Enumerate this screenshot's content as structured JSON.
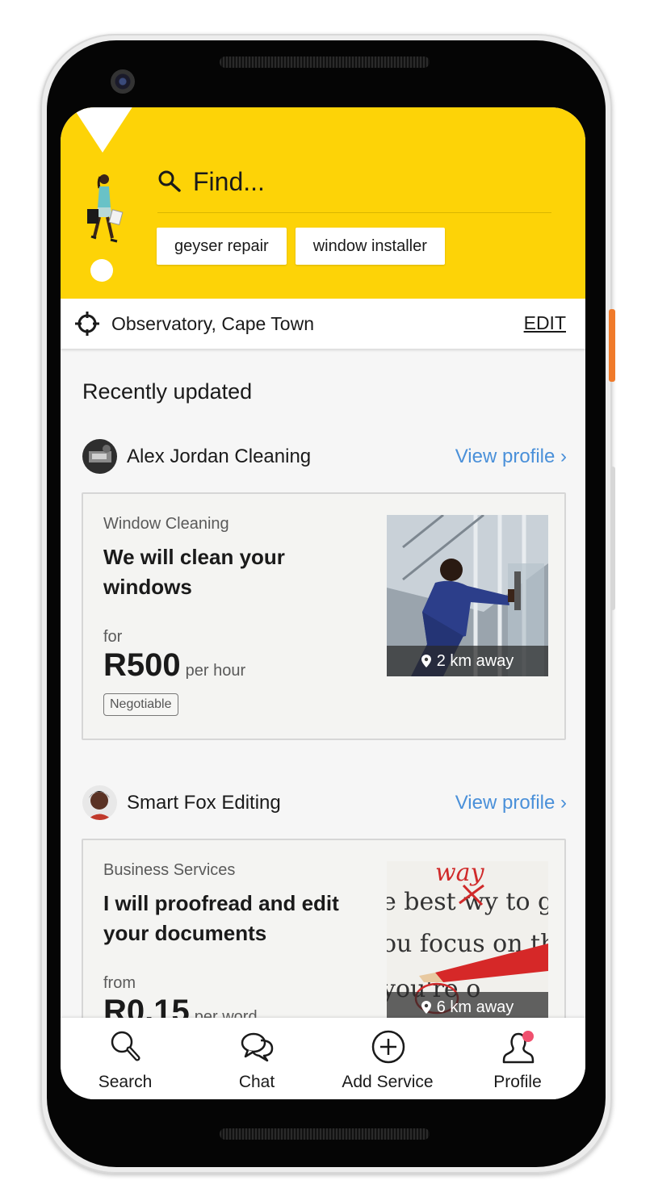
{
  "header": {
    "search_placeholder": "Find...",
    "chips": [
      "geyser repair",
      "window installer"
    ]
  },
  "location": {
    "text": "Observatory, Cape Town",
    "edit_label": "EDIT"
  },
  "section_title": "Recently updated",
  "listings": [
    {
      "provider": "Alex Jordan Cleaning",
      "view_profile": "View profile ›",
      "category": "Window Cleaning",
      "title": "We will clean your windows",
      "price_prefix": "for",
      "price": "R500",
      "price_unit": "per hour",
      "badge": "Negotiable",
      "distance": "2 km away"
    },
    {
      "provider": "Smart Fox Editing",
      "view_profile": "View profile ›",
      "category": "Business Services",
      "title": "I will proofread and edit your documents",
      "price_prefix": "from",
      "price": "R0.15",
      "price_unit": "per word",
      "distance": "6 km away"
    }
  ],
  "nav": [
    {
      "label": "Search",
      "icon": "search-icon"
    },
    {
      "label": "Chat",
      "icon": "chat-icon"
    },
    {
      "label": "Add Service",
      "icon": "add-icon"
    },
    {
      "label": "Profile",
      "icon": "profile-icon"
    }
  ],
  "colors": {
    "brand_yellow": "#fdd307",
    "link_blue": "#4a90d9",
    "notification_dot": "#f0506e"
  }
}
